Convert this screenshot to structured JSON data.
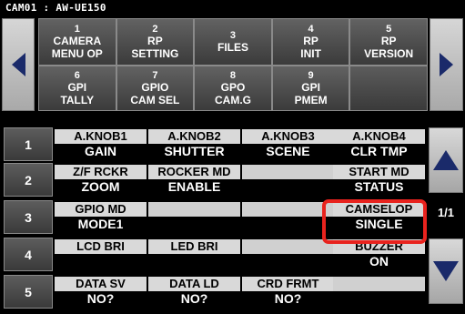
{
  "title": "CAM01 : AW-UE150",
  "menu": [
    {
      "num": "1",
      "line1": "CAMERA",
      "line2": "MENU OP"
    },
    {
      "num": "2",
      "line1": "RP",
      "line2": "SETTING"
    },
    {
      "num": "3",
      "line1": "FILES",
      "line2": ""
    },
    {
      "num": "4",
      "line1": "RP",
      "line2": "INIT"
    },
    {
      "num": "5",
      "line1": "RP",
      "line2": "VERSION"
    },
    {
      "num": "6",
      "line1": "GPI",
      "line2": "TALLY"
    },
    {
      "num": "7",
      "line1": "GPIO",
      "line2": "CAM SEL"
    },
    {
      "num": "8",
      "line1": "GPO",
      "line2": "CAM.G"
    },
    {
      "num": "9",
      "line1": "GPI",
      "line2": "PMEM"
    },
    {
      "num": "",
      "line1": "",
      "line2": ""
    }
  ],
  "rows": [
    {
      "num": "1",
      "slots": [
        {
          "label": "A.KNOB1",
          "value": "GAIN"
        },
        {
          "label": "A.KNOB2",
          "value": "SHUTTER"
        },
        {
          "label": "A.KNOB3",
          "value": "SCENE"
        },
        {
          "label": "A.KNOB4",
          "value": "CLR TMP"
        }
      ]
    },
    {
      "num": "2",
      "slots": [
        {
          "label": "Z/F RCKR",
          "value": "ZOOM"
        },
        {
          "label": "ROCKER MD",
          "value": "ENABLE"
        },
        {
          "label": "",
          "value": ""
        },
        {
          "label": "START  MD",
          "value": "STATUS"
        }
      ]
    },
    {
      "num": "3",
      "slots": [
        {
          "label": "GPIO  MD",
          "value": "MODE1"
        },
        {
          "label": "",
          "value": ""
        },
        {
          "label": "",
          "value": ""
        },
        {
          "label": "CAMSELOP",
          "value": "SINGLE"
        }
      ]
    },
    {
      "num": "4",
      "slots": [
        {
          "label": "LCD BRI",
          "value": ""
        },
        {
          "label": "LED BRI",
          "value": ""
        },
        {
          "label": "",
          "value": ""
        },
        {
          "label": "BUZZER",
          "value": "ON"
        }
      ]
    },
    {
      "num": "5",
      "slots": [
        {
          "label": "DATA SV",
          "value": "NO?"
        },
        {
          "label": "DATA LD",
          "value": "NO?"
        },
        {
          "label": "CRD FRMT",
          "value": "NO?"
        },
        {
          "label": "",
          "value": ""
        }
      ]
    }
  ],
  "page_indicator": "1/1",
  "icons": {
    "nav_left": "left-arrow-icon",
    "nav_right": "right-arrow-icon",
    "scroll_up": "up-arrow-icon",
    "scroll_down": "down-arrow-icon"
  },
  "colors": {
    "highlight": "#e8231e",
    "arrow": "#1a2a6a"
  }
}
